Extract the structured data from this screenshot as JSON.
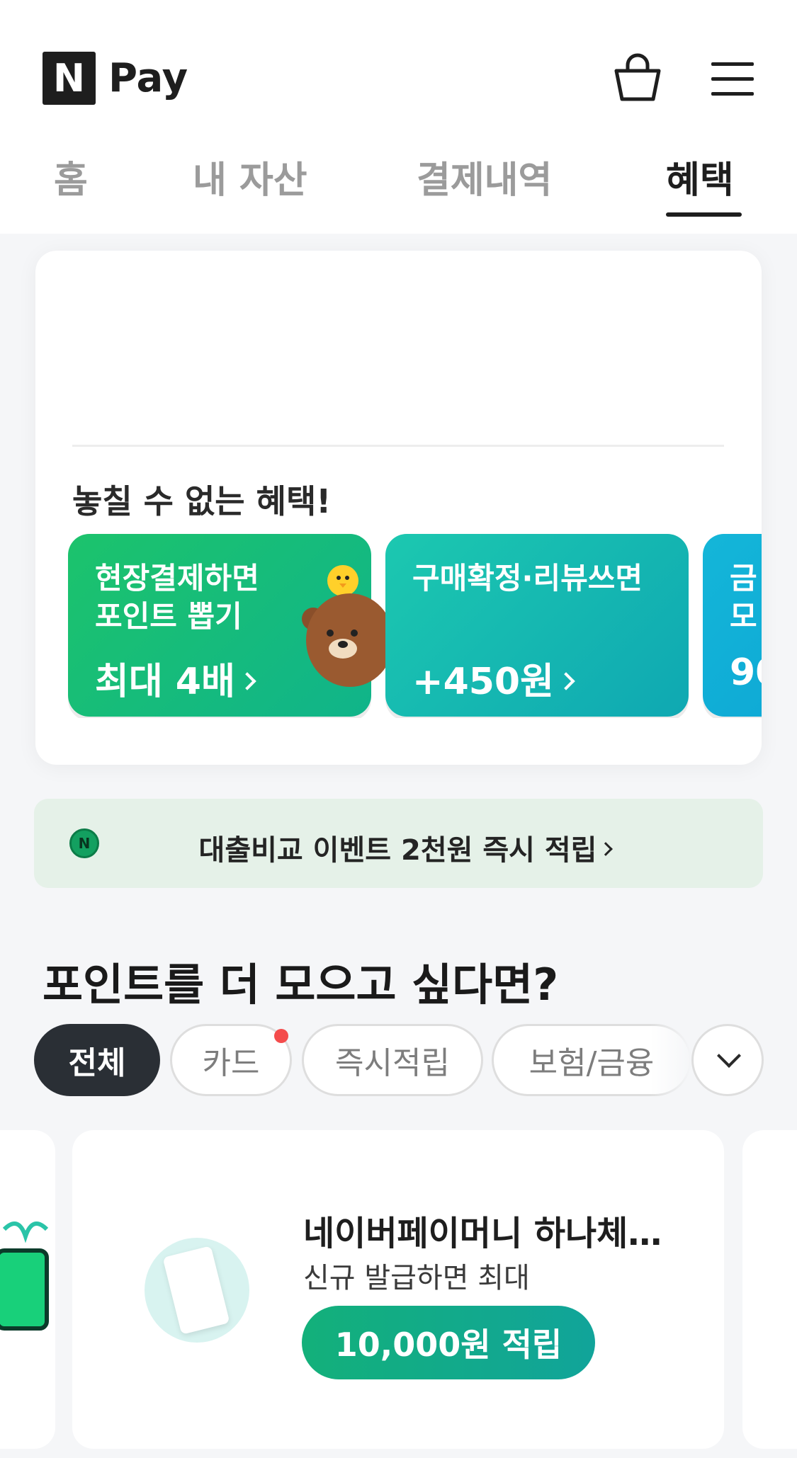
{
  "header": {
    "logo_letter": "N",
    "logo_text": "Pay",
    "icons": [
      "shopping-bag-icon",
      "hamburger-menu-icon"
    ]
  },
  "tabs": [
    {
      "label": "홈",
      "active": false
    },
    {
      "label": "내 자산",
      "active": false
    },
    {
      "label": "결제내역",
      "active": false
    },
    {
      "label": "혜택",
      "active": true
    }
  ],
  "benefits": {
    "title": "놓칠 수 없는 혜택!",
    "cards": [
      {
        "line1": "현장결제하면\n포인트 뽑기",
        "line2": "최대 4배",
        "color": "#1cc36c"
      },
      {
        "line1": "구매확정·리뷰쓰면",
        "line2": "+450원",
        "color": "#16b8ac"
      },
      {
        "line1": "금\n모",
        "line2": "90",
        "color": "#10acd8"
      }
    ]
  },
  "banner": {
    "text": "대출비교 이벤트 2천원 즉시 적립",
    "icon": "naver-coin-icon"
  },
  "points_section": {
    "title": "포인트를 더 모으고 싶다면?",
    "chips": [
      {
        "label": "전체",
        "active": true
      },
      {
        "label": "카드",
        "active": false,
        "new_dot": true
      },
      {
        "label": "즉시적립",
        "active": false
      },
      {
        "label": "보험/금융",
        "active": false
      }
    ]
  },
  "offer_card": {
    "title": "네이버페이머니 하나체…",
    "subtitle": "신규 발급하면 최대",
    "cta": "10,000원 적립",
    "thumb_icon": "card-icon"
  }
}
